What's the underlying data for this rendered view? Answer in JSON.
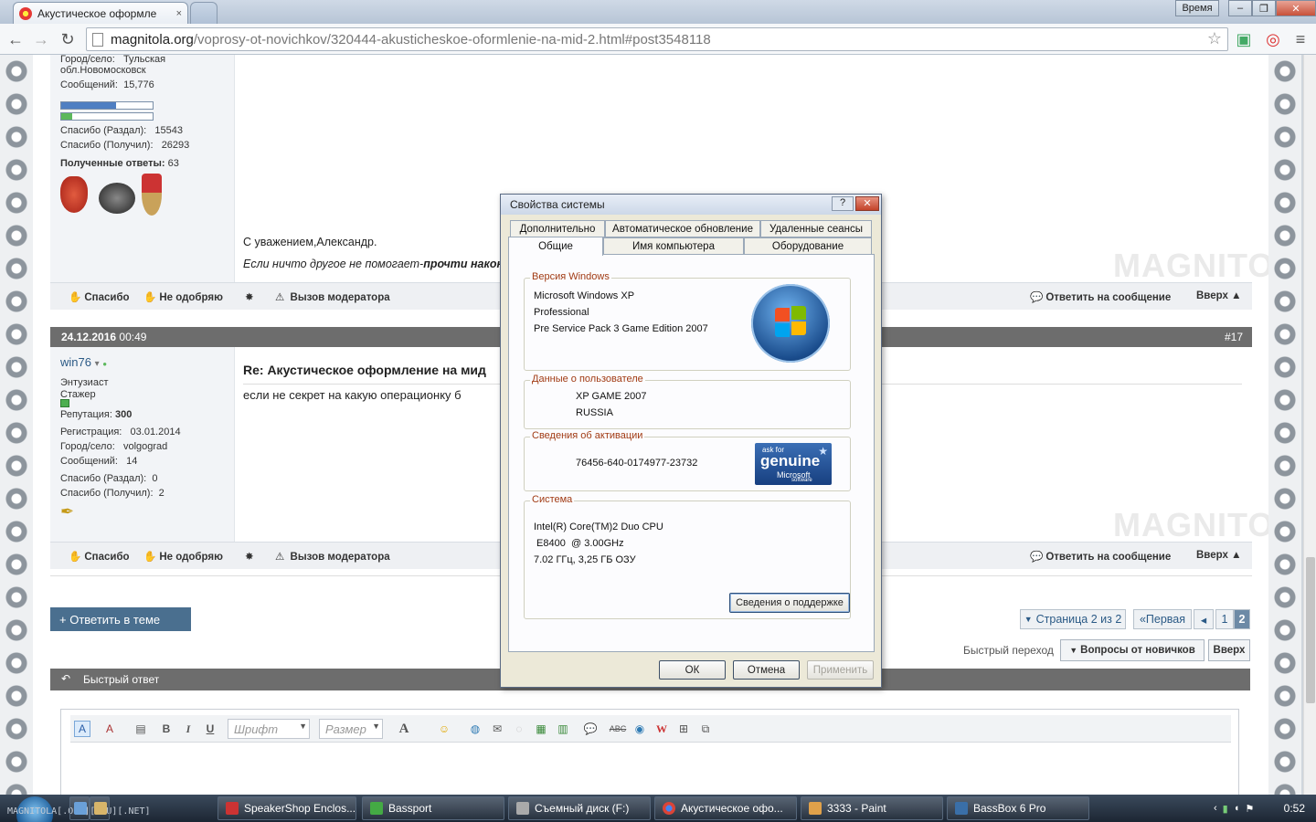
{
  "browser": {
    "tab_title": "Акустическое оформле",
    "tab_close": "×",
    "url_domain": "magnitola.org",
    "url_path": "/voprosy-ot-novichkov/320444-akusticheskoe-oformlenie-na-mid-2.html#post3548118",
    "time_label": "Время",
    "minimize": "–",
    "restore": "❐",
    "close": "✕"
  },
  "post1": {
    "city_label": "Город/село:",
    "city_value": "Тульская",
    "city_value2": "обл.Новомосковск",
    "messages_label": "Сообщений:",
    "messages_value": "15,776",
    "thanks_given_label": "Спасибо (Раздал):",
    "thanks_given_value": "15543",
    "thanks_got_label": "Спасибо (Получил):",
    "thanks_got_value": "26293",
    "answers_label": "Полученные ответы:",
    "answers_value": "63",
    "signature_line1": "С уважением,Александр.",
    "signature_line2_italic": "Если ничто другое не помогает-",
    "signature_line2_bold": "прочти наконе"
  },
  "actions": {
    "thanks": "Спасибо",
    "disapprove": "Не одобряю",
    "call_moderator": "Вызов модератора",
    "reply_to_message": "Ответить на сообщение",
    "up": "Вверх ▲"
  },
  "post2": {
    "date": "24.12.2016",
    "time": "00:49",
    "number": "#17",
    "username": "win76",
    "title1": "Энтузиаст",
    "title2": "Стажер",
    "reputation_label": "Репутация:",
    "reputation_value": "300",
    "registration_label": "Регистрация:",
    "registration_value": "03.01.2014",
    "city_label": "Город/село:",
    "city_value": "volgograd",
    "messages_label": "Сообщений:",
    "messages_value": "14",
    "thanks_given_label": "Спасибо (Раздал):",
    "thanks_given_value": "0",
    "thanks_got_label": "Спасибо (Получил):",
    "thanks_got_value": "2",
    "post_title": "Re: Акустическое оформление на мид",
    "post_body": "если не секрет на какую операционку б"
  },
  "page_nav": {
    "reply_in_topic": "+ Ответить в теме",
    "page_of": "Страница 2 из 2",
    "first": "«Первая",
    "prev": "◂",
    "page1": "1",
    "page2": "2",
    "quick_jump_label": "Быстрый переход",
    "quick_jump_select": "Вопросы от новичков",
    "up": "Вверх"
  },
  "quick_reply": {
    "header": "Быстрый ответ",
    "font_placeholder": "Шрифт",
    "size_placeholder": "Размер"
  },
  "watermark": "MAGNITOLA",
  "dialog": {
    "title": "Свойства системы",
    "help": "?",
    "close": "✕",
    "tabs_row1": [
      "Дополнительно",
      "Автоматическое обновление",
      "Удаленные сеансы"
    ],
    "tabs_row2": [
      "Общие",
      "Имя компьютера",
      "Оборудование"
    ],
    "windows_group": "Версия Windows",
    "windows_line1": "Microsoft Windows XP",
    "windows_line2": "Professional",
    "windows_line3": "Pre Service Pack 3 Game Edition 2007",
    "user_group": "Данные о пользователе",
    "user_line1": "XP GAME 2007",
    "user_line2": "RUSSIA",
    "activation_group": "Сведения об активации",
    "activation_key": "76456-640-0174977-23732",
    "genuine_ask": "ask for",
    "genuine_word": "genuine",
    "genuine_ms": "Microsoft",
    "genuine_sw": "software",
    "system_group": "Система",
    "system_line1": "Intel(R) Core(TM)2 Duo CPU",
    "system_line2": " E8400  @ 3.00GHz",
    "system_line3": "7.02 ГГц, 3,25 ГБ ОЗУ",
    "support_button": "Сведения о поддержке",
    "ok": "ОК",
    "cancel": "Отмена",
    "apply": "Применить"
  },
  "taskbar": {
    "watermark": "MAGNITOLA[.ORG][.RU][.NET]",
    "items": [
      "SpeakerShop Enclos...",
      "Basspor​t",
      "Съемный диск (F:)",
      "Акустическое офо...",
      "3333 - Paint",
      "BassBox 6 Pro"
    ],
    "clock": "0:52"
  }
}
